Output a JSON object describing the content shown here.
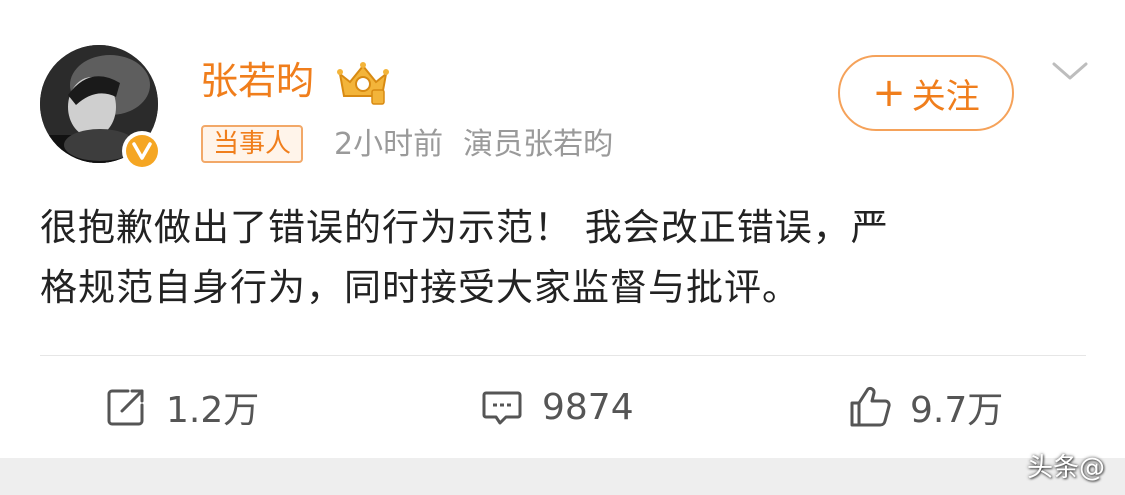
{
  "post": {
    "username": "张若昀",
    "tag": "当事人",
    "time": "2小时前",
    "source": "演员张若昀",
    "follow_plus": "+",
    "follow_label": "关注",
    "content_line1": "很抱歉做出了错误的行为示范！ 我会改正错误，严",
    "content_line2": "格规范自身行为，同时接受大家监督与批评。"
  },
  "actions": {
    "repost_count": "1.2万",
    "comment_count": "9874",
    "like_count": "9.7万"
  },
  "watermark": "头条@"
}
